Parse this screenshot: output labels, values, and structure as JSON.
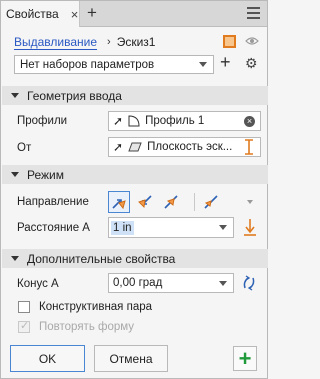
{
  "tab": {
    "label": "Свойства",
    "close": "×",
    "add": "+"
  },
  "breadcrumb": {
    "operation": "Выдавливание",
    "separator": "›",
    "sketch": "Эскиз1"
  },
  "preset": {
    "value": "Нет наборов параметров",
    "add": "+",
    "settings": "⚙"
  },
  "sections": {
    "input_geometry": "Геометрия ввода",
    "mode": "Режим",
    "advanced": "Дополнительные свойства"
  },
  "input_geometry": {
    "profiles_label": "Профили",
    "profiles_value": "Профиль 1",
    "from_label": "От",
    "from_value": "Плоскость эск..."
  },
  "mode": {
    "direction_label": "Направление",
    "distance_label": "Расстояние A",
    "distance_value": "1 in"
  },
  "advanced": {
    "taper_label": "Конус A",
    "taper_value": "0,00 град",
    "construction_label": "Конструктивная пара",
    "repeat_label": "Повторять форму"
  },
  "footer": {
    "ok": "OK",
    "cancel": "Отмена",
    "apply": "+"
  },
  "colors": {
    "link": "#2b59c3",
    "accent_orange": "#e07b20",
    "plus_green": "#1f9a3a",
    "selection_blue": "#4a86d1"
  }
}
